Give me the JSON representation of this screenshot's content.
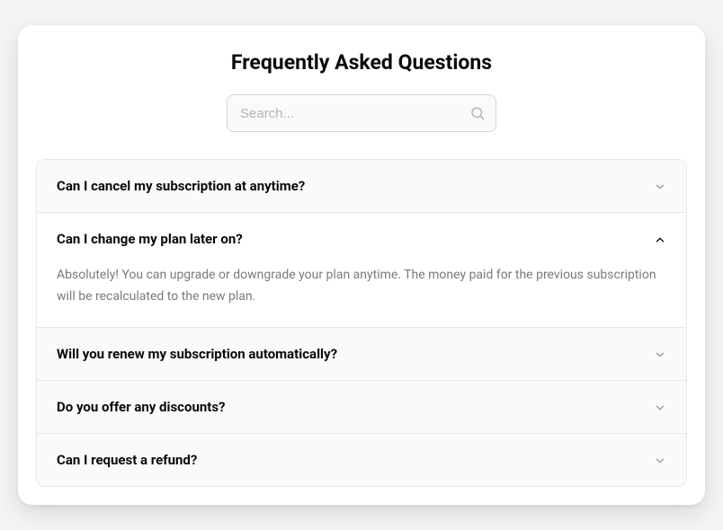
{
  "title": "Frequently Asked Questions",
  "search": {
    "placeholder": "Search...",
    "value": ""
  },
  "faq": {
    "items": [
      {
        "question": "Can I cancel my subscription at anytime?",
        "expanded": false,
        "answer": ""
      },
      {
        "question": "Can I change my plan later on?",
        "expanded": true,
        "answer": "Absolutely! You can upgrade or downgrade your plan anytime. The money paid for the previous subscription will be recalculated to the new plan."
      },
      {
        "question": "Will you renew my subscription automatically?",
        "expanded": false,
        "answer": ""
      },
      {
        "question": "Do you offer any discounts?",
        "expanded": false,
        "answer": ""
      },
      {
        "question": "Can I request a refund?",
        "expanded": false,
        "answer": ""
      }
    ]
  }
}
